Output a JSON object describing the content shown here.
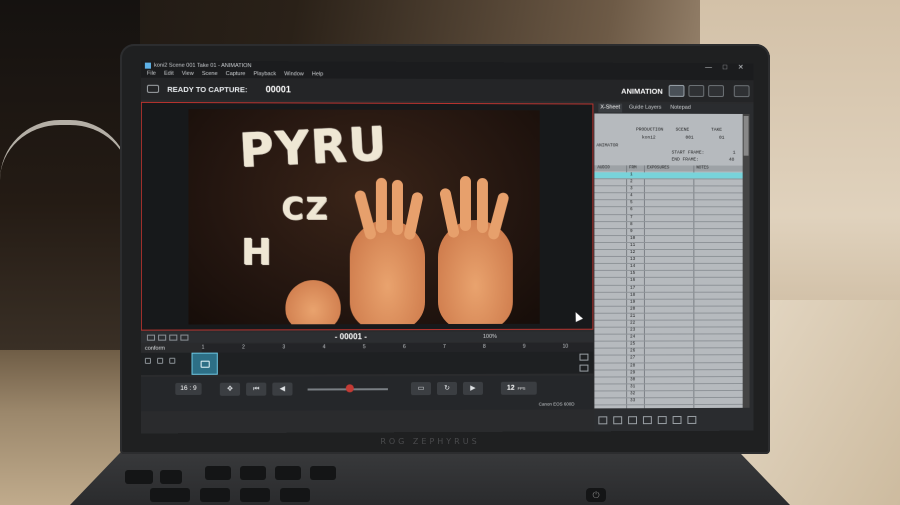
{
  "app": {
    "title": "koni2  Scene 001  Take 01 - ANIMATION",
    "window_controls": [
      "—",
      "□",
      "✕"
    ]
  },
  "menu": [
    "File",
    "Edit",
    "View",
    "Scene",
    "Capture",
    "Playback",
    "Window",
    "Help"
  ],
  "toolbar": {
    "status": "READY TO CAPTURE:",
    "frame": "00001",
    "mode": "ANIMATION"
  },
  "viewer": {
    "rice_letters_top": "PYRU",
    "rice_letters_mid": "CZ",
    "rice_letters_low": "H"
  },
  "timeline": {
    "counter": "- 00001 -",
    "zoom": "100%",
    "track_label": "conform",
    "ruler": [
      "1",
      "2",
      "3",
      "4",
      "5",
      "6",
      "7",
      "8",
      "9",
      "10"
    ]
  },
  "controls": {
    "ratio": "16 : 9",
    "fps_value": "12",
    "fps_unit": "FPS",
    "camera": "Canon EOS 600D"
  },
  "xsheet": {
    "tabs": [
      "X-Sheet",
      "Guide Layers",
      "Notepad"
    ],
    "production_label": "PRODUCTION",
    "scene_label": "SCENE",
    "take_label": "TAKE",
    "production": "koni2",
    "scene": "001",
    "take": "01",
    "animator_label": "ANIMATOR",
    "start_frame_label": "START FRAME:",
    "start_frame": "1",
    "end_frame_label": "END FRAME:",
    "end_frame": "48",
    "columns": [
      "AUDIO",
      "FRM",
      "EXPOSURES",
      "NOTES"
    ],
    "rows": [
      "1",
      "2",
      "3",
      "4",
      "5",
      "6",
      "7",
      "8",
      "9",
      "10",
      "11",
      "12",
      "13",
      "14",
      "15",
      "16",
      "17",
      "18",
      "19",
      "20",
      "21",
      "22",
      "23",
      "24",
      "25",
      "26",
      "27",
      "28",
      "29",
      "30",
      "31",
      "32",
      "33"
    ]
  },
  "laptop": {
    "brand": "ROG ZEPHYRUS"
  }
}
